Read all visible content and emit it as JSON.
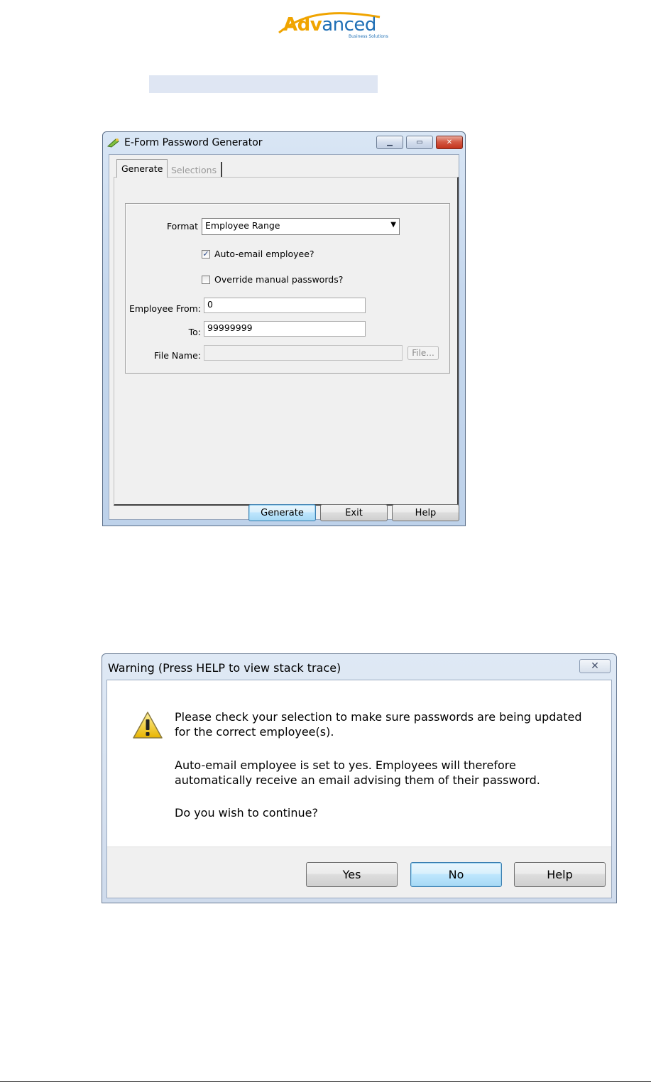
{
  "logo": {
    "brand_part1": "Adv",
    "brand_part2": "anced",
    "tagline": "Business Solutions"
  },
  "window1": {
    "title": "E-Form Password Generator",
    "icon": "key-pencil-icon",
    "tabs": [
      {
        "label": "Generate"
      },
      {
        "label": "Selections"
      }
    ],
    "format_label": "Format",
    "format_value": "Employee Range",
    "auto_email_label": "Auto-email employee?",
    "auto_email_checked": true,
    "override_label": "Override manual passwords?",
    "override_checked": false,
    "employee_from_label": "Employee From:",
    "employee_from_value": "0",
    "to_label": "To:",
    "to_value": "99999999",
    "file_name_label": "File Name:",
    "file_name_value": "",
    "file_button": "File...",
    "buttons": {
      "generate": "Generate",
      "exit": "Exit",
      "help": "Help"
    }
  },
  "dialog": {
    "title": "Warning (Press HELP to view stack trace)",
    "icon": "warning-icon",
    "line1": "Please check your selection to make sure passwords are being updated",
    "line2": "for the correct employee(s).",
    "line3": "Auto-email employee is set to yes. Employees will therefore",
    "line4": "automatically receive an email advising them of their password.",
    "line5": "Do you wish to continue?",
    "buttons": {
      "yes": "Yes",
      "no": "No",
      "help": "Help"
    }
  },
  "colors": {
    "accent_orange": "#f0a400",
    "accent_blue": "#1f6fb5"
  }
}
